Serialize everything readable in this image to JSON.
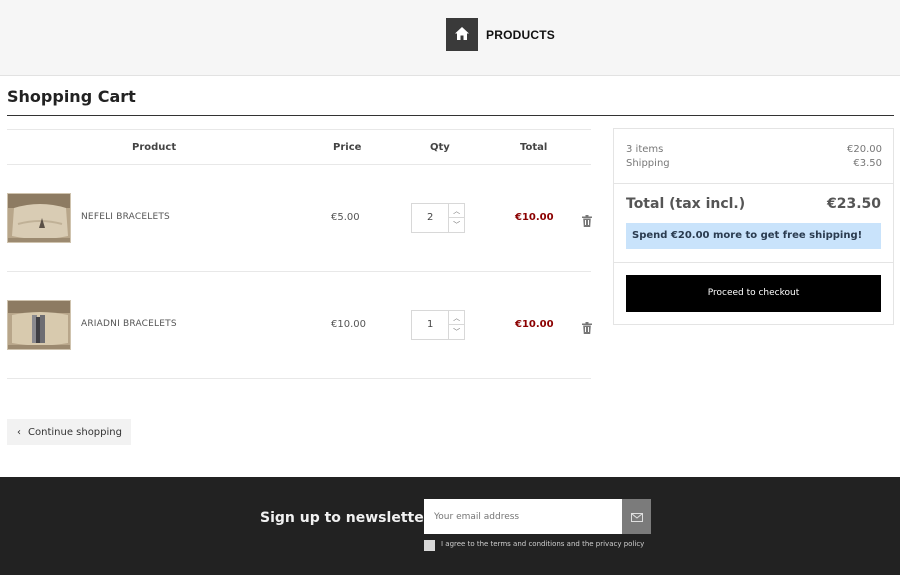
{
  "header": {
    "home_icon": "home-icon",
    "nav_label": "PRODUCTS"
  },
  "page": {
    "title": "Shopping Cart"
  },
  "cart": {
    "columns": {
      "product": "Product",
      "price": "Price",
      "qty": "Qty",
      "total": "Total"
    },
    "items": [
      {
        "name": "NEFELI BRACELETS",
        "price": "€5.00",
        "qty": "2",
        "total": "€10.00",
        "thumb_icon": "product-thumbnail"
      },
      {
        "name": "ARIADNI BRACELETS",
        "price": "€10.00",
        "qty": "1",
        "total": "€10.00",
        "thumb_icon": "product-thumbnail"
      }
    ],
    "continue_label": "Continue shopping"
  },
  "summary": {
    "items_label": "3 items",
    "items_value": "€20.00",
    "shipping_label": "Shipping",
    "shipping_value": "€3.50",
    "total_label": "Total (tax incl.)",
    "total_value": "€23.50",
    "shipping_note": "Spend €20.00 more to get free shipping!",
    "checkout_label": "Proceed to checkout"
  },
  "footer": {
    "newsletter_title": "Sign up to newsletter",
    "email_placeholder": "Your email address",
    "agree_text": "I agree to the terms and conditions and the privacy policy"
  },
  "colors": {
    "accent_total": "#8b0000",
    "notice_bg": "#c9e3fb",
    "checkout_bg": "#000000",
    "footer_bg": "#222222"
  }
}
